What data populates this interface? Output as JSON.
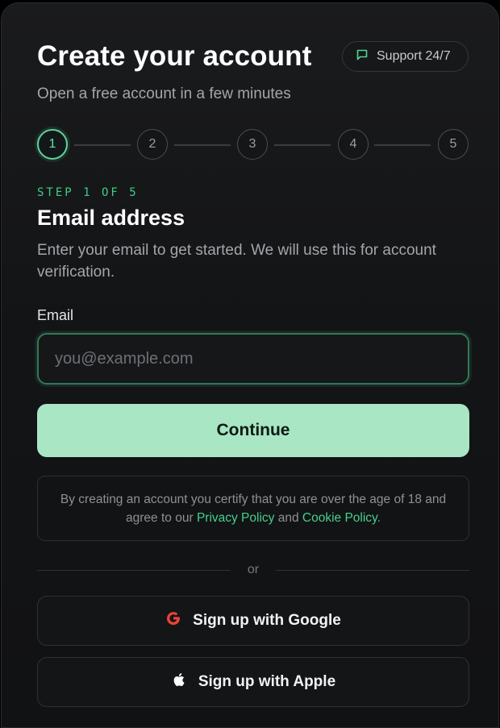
{
  "header": {
    "title": "Create your account",
    "subtitle": "Open a free account in a few minutes",
    "support_label": "Support 24/7"
  },
  "stepper": {
    "steps": [
      "1",
      "2",
      "3",
      "4",
      "5"
    ],
    "active": "1"
  },
  "section": {
    "step_label": "STEP 1 OF 5",
    "title": "Email address",
    "description": "Enter your email to get started. We will use this for account verification."
  },
  "form": {
    "email_label": "Email",
    "email_placeholder": "you@example.com",
    "email_value": "",
    "continue_label": "Continue"
  },
  "terms": {
    "text_before": "By creating an account you certify that you are over the age of 18 and agree to our ",
    "privacy_link": "Privacy Policy",
    "text_middle": " and ",
    "cookie_link": "Cookie Policy",
    "text_after": "."
  },
  "divider": {
    "label": "or"
  },
  "social": {
    "google_label": "Sign up with Google",
    "apple_label": "Sign up with Apple"
  },
  "colors": {
    "accent": "#3fcf87",
    "button_bg": "#a8e6c4",
    "background": "#131416",
    "google_red": "#ea4335"
  },
  "icons": {
    "support": "chat-bubble-icon",
    "google": "google-icon",
    "apple": "apple-icon"
  }
}
